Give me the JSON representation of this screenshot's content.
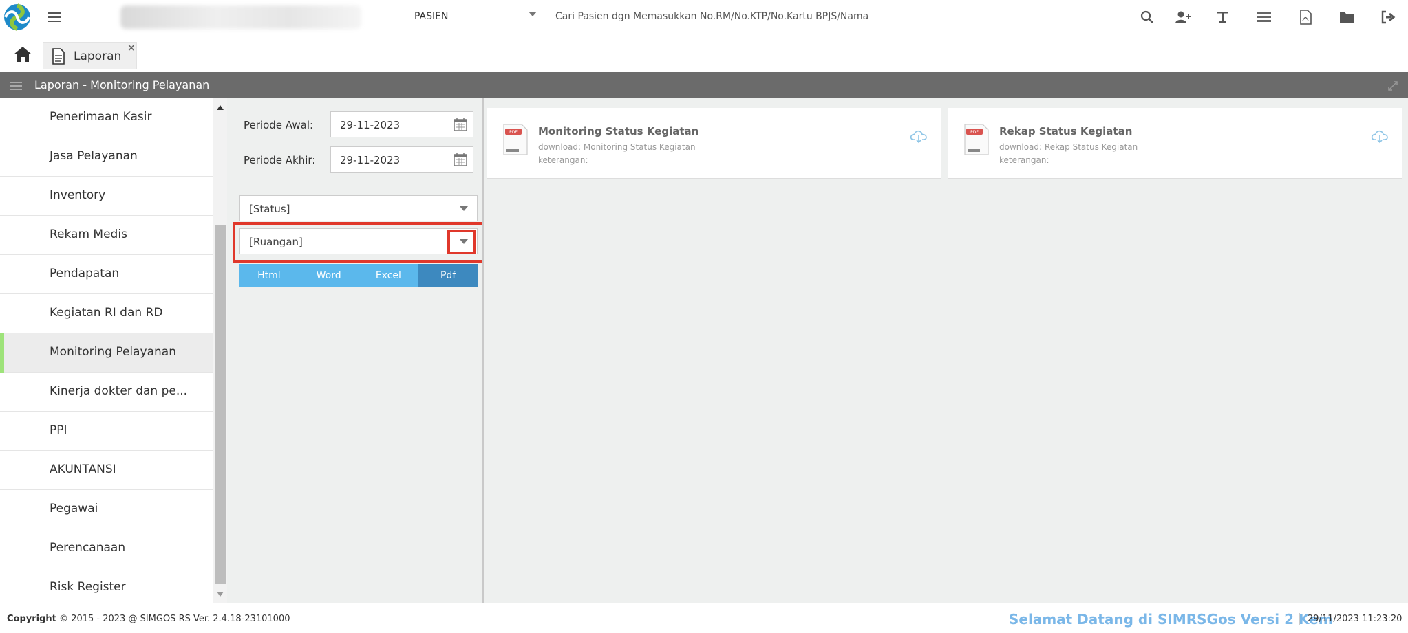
{
  "topbar": {
    "pasien_label": "PASIEN",
    "search_placeholder": "Cari Pasien dgn Memasukkan No.RM/No.KTP/No.Kartu BPJS/Nama"
  },
  "tabs": [
    {
      "label": "Laporan",
      "close": "×"
    }
  ],
  "panel": {
    "title": "Laporan - Monitoring Pelayanan"
  },
  "sidebar": {
    "items": [
      {
        "label": "Penerimaan Kasir"
      },
      {
        "label": "Jasa Pelayanan"
      },
      {
        "label": "Inventory"
      },
      {
        "label": "Rekam Medis"
      },
      {
        "label": "Pendapatan"
      },
      {
        "label": "Kegiatan RI dan RD"
      },
      {
        "label": "Monitoring Pelayanan",
        "active": true
      },
      {
        "label": "Kinerja dokter dan pe..."
      },
      {
        "label": "PPI"
      },
      {
        "label": "AKUNTANSI"
      },
      {
        "label": "Pegawai"
      },
      {
        "label": "Perencanaan"
      },
      {
        "label": "Risk Register"
      }
    ]
  },
  "form": {
    "periode_awal_label": "Periode Awal:",
    "periode_awal_value": "29-11-2023",
    "periode_akhir_label": "Periode Akhir:",
    "periode_akhir_value": "29-11-2023",
    "status_value": "[Status]",
    "ruangan_value": "[Ruangan]",
    "buttons": [
      "Html",
      "Word",
      "Excel",
      "Pdf"
    ]
  },
  "reports": [
    {
      "title": "Monitoring Status Kegiatan",
      "download": "download: Monitoring Status Kegiatan",
      "note": "keterangan:"
    },
    {
      "title": "Rekap Status Kegiatan",
      "download": "download: Rekap Status Kegiatan",
      "note": "keterangan:"
    }
  ],
  "footer": {
    "copyright": "2015 - 2023 @ SIMGOS RS Ver. 2.4.18-23101000",
    "copyright_label": "Copyright",
    "welcome": "Selamat Datang di SIMRSGos Versi 2 Kem",
    "datetime": "29/11/2023 11:23:20"
  },
  "colors": {
    "accent": "#5bb8ec",
    "pdf": "#3d89bf",
    "highlight": "#e0382b",
    "active_marker": "#9ee37a"
  }
}
